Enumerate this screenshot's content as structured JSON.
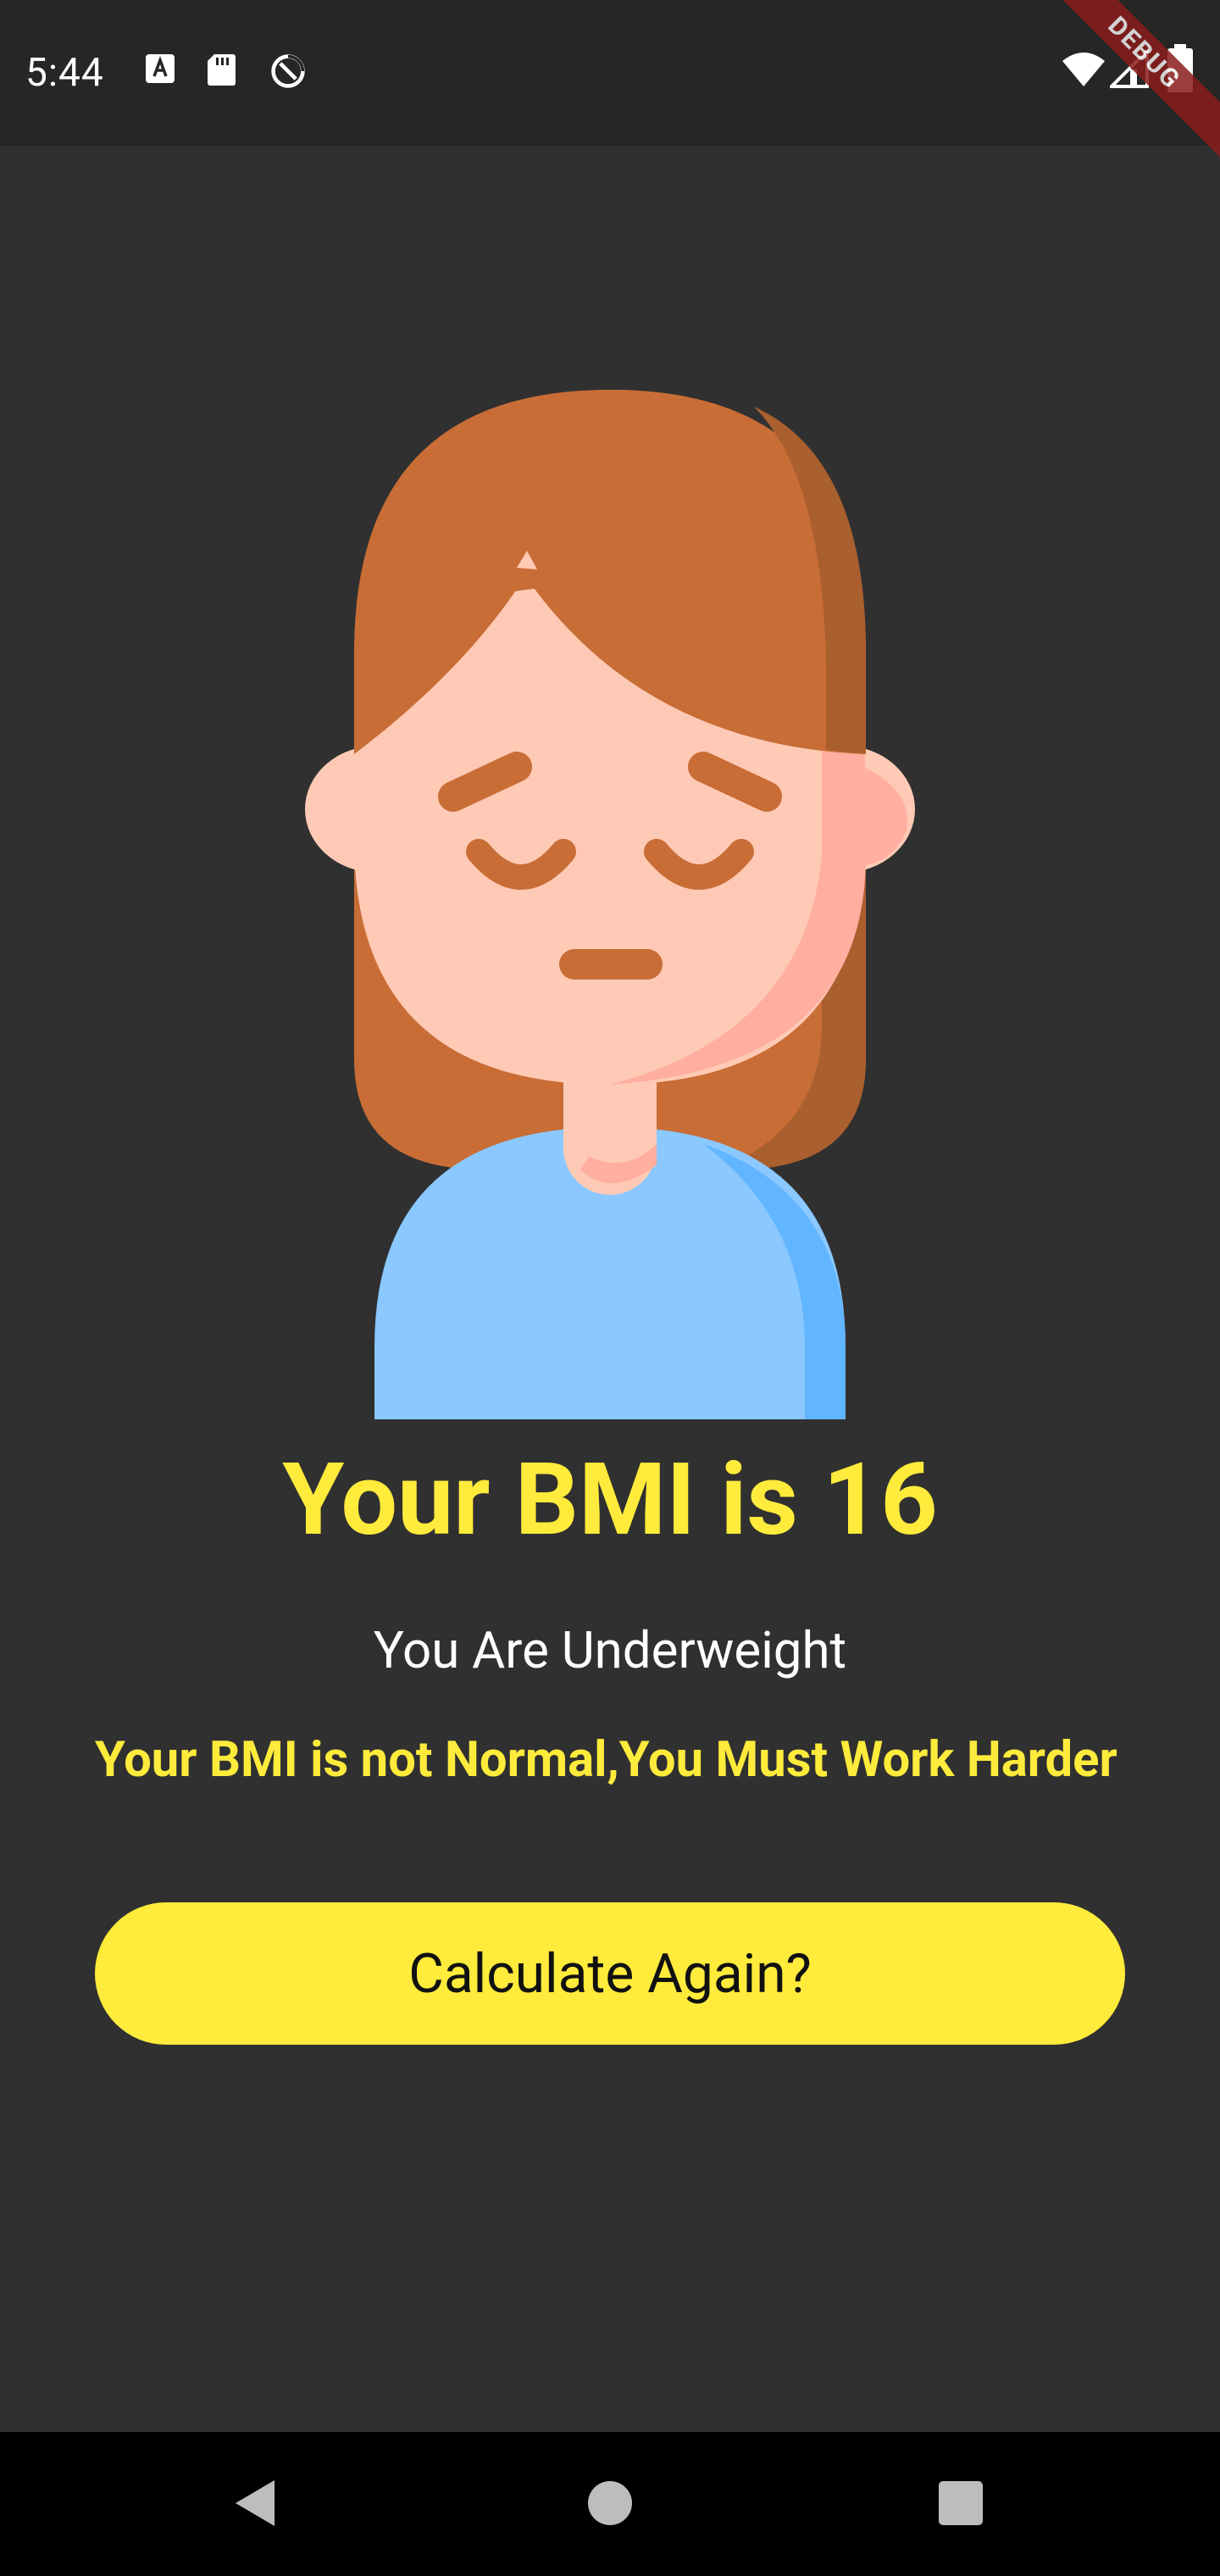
{
  "status_bar": {
    "time": "5:44",
    "left_icons": [
      "keyboard-a-icon",
      "sd-card-icon",
      "data-saver-icon"
    ],
    "right_icons": [
      "wifi-icon",
      "signal-icon",
      "battery-icon"
    ],
    "debug_label": "DEBUG"
  },
  "result": {
    "title": "Your BMI is 16",
    "status": "You Are Underweight",
    "advice": "Your BMI is not Normal,You Must Work Harder"
  },
  "actions": {
    "calculate_again_label": "Calculate Again?"
  },
  "nav_bar": {
    "icons": [
      "back-icon",
      "home-icon",
      "recents-icon"
    ]
  },
  "colors": {
    "background": "#303030",
    "accent": "#ffeb3b",
    "text": "#ffffff"
  }
}
